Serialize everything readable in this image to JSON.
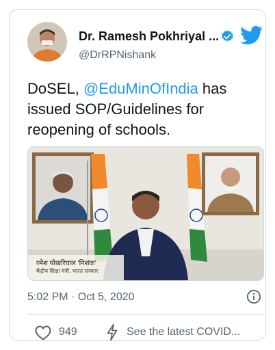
{
  "author": {
    "name": "Dr. Ramesh Pokhriyal ...",
    "handle": "@DrRPNishank"
  },
  "tweet": {
    "prefix": "DoSEL, ",
    "mention": "@EduMinOfIndia",
    "suffix": " has issued SOP/Guidelines for reopening of schools."
  },
  "media": {
    "caption_name": "रमेश पोखरियाल 'निशंक'",
    "caption_title": "केंद्रीय शिक्षा मंत्री, भारत सरकार"
  },
  "meta": {
    "timestamp": "5:02 PM · Oct 5, 2020"
  },
  "actions": {
    "like_count": "949",
    "latest_label": "See the latest COVID..."
  },
  "colors": {
    "accent": "#1d9bf0",
    "muted": "#536471",
    "border": "#cfd9de"
  },
  "icons": [
    "verified-badge-icon",
    "twitter-bird-icon",
    "info-icon",
    "heart-icon",
    "lightning-icon"
  ]
}
